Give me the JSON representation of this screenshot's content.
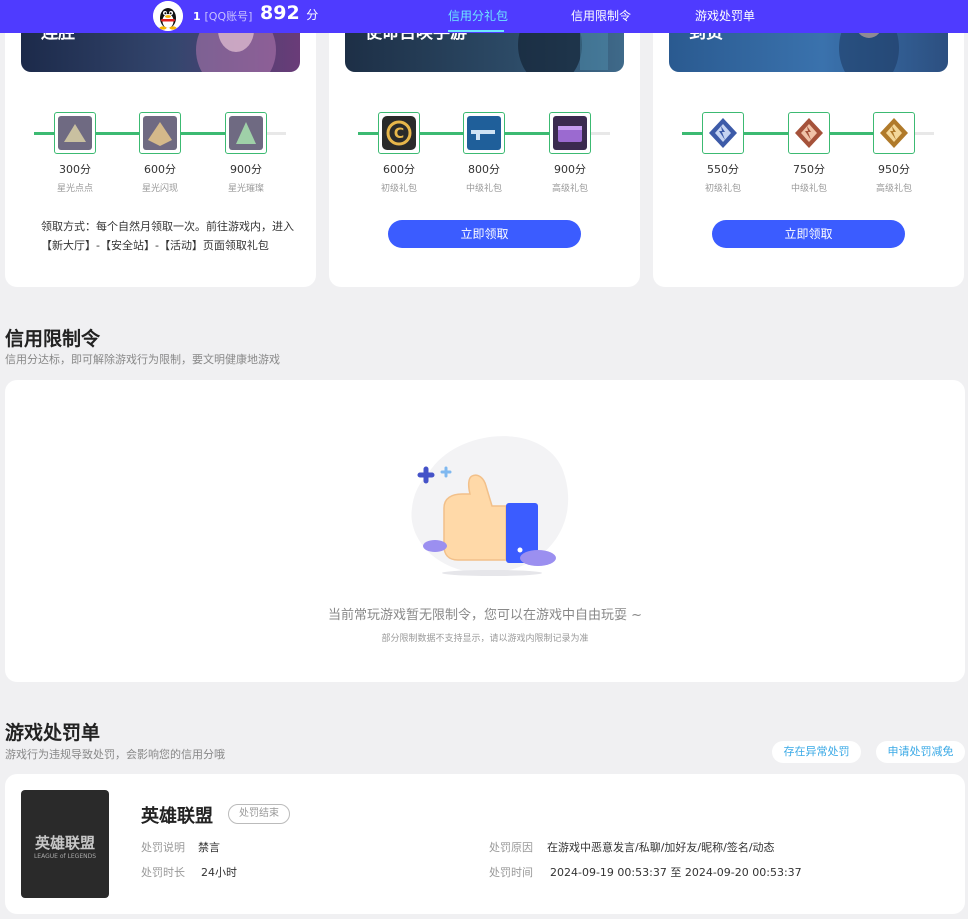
{
  "header": {
    "account_id": "1",
    "account_type": "[QQ账号]",
    "score": "892",
    "score_unit": "分",
    "nav": [
      {
        "label": "信用分礼包"
      },
      {
        "label": "信用限制令"
      },
      {
        "label": "游戏处罚单"
      }
    ]
  },
  "gift_cards": [
    {
      "banner_text": "连胜",
      "tiers": [
        {
          "points": "300分",
          "name": "星光点点"
        },
        {
          "points": "600分",
          "name": "星光闪现"
        },
        {
          "points": "900分",
          "name": "星光璀璨"
        }
      ],
      "progress_fraction": 0.8,
      "howto": "领取方式：每个自然月领取一次。前往游戏内，进入【新大厅】-【安全站】-【活动】页面领取礼包"
    },
    {
      "banner_text": "使命召唤手游",
      "tiers": [
        {
          "points": "600分",
          "name": "初级礼包"
        },
        {
          "points": "800分",
          "name": "中级礼包"
        },
        {
          "points": "900分",
          "name": "高级礼包"
        }
      ],
      "progress_fraction": 0.8,
      "claim_label": "立即领取"
    },
    {
      "banner_text": "到货",
      "tiers": [
        {
          "points": "550分",
          "name": "初级礼包"
        },
        {
          "points": "750分",
          "name": "中级礼包"
        },
        {
          "points": "950分",
          "name": "高级礼包"
        }
      ],
      "progress_fraction": 0.8,
      "claim_label": "立即领取"
    }
  ],
  "restriction": {
    "title": "信用限制令",
    "subtitle": "信用分达标，即可解除游戏行为限制，要文明健康地游戏",
    "empty_main": "当前常玩游戏暂无限制令，您可以在游戏中自由玩耍 ~",
    "empty_sub": "部分限制数据不支持显示，请以游戏内限制记录为准"
  },
  "penalty": {
    "title": "游戏处罚单",
    "subtitle": "游戏行为违规导致处罚，会影响您的信用分哦",
    "btn_abnormal": "存在异常处罚",
    "btn_reduce": "申请处罚减免",
    "item": {
      "logo_text": "英雄联盟",
      "logo_sub": "LEAGUE of LEGENDS",
      "game": "英雄联盟",
      "status": "处罚结束",
      "desc_label": "处罚说明",
      "desc_value": "禁言",
      "dur_label": "处罚时长",
      "dur_value": "24小时",
      "reason_label": "处罚原因",
      "reason_value": "在游戏中恶意发言/私聊/加好友/昵称/签名/动态",
      "time_label": "处罚时间",
      "time_value": "2024-09-19 00:53:37 至 2024-09-20 00:53:37"
    }
  },
  "colors": {
    "topbar": "#4f3bff",
    "accent_blue": "#3b5cff",
    "progress_green": "#3cba72",
    "nav_active": "#6ee7ff",
    "pill_text": "#3aa9e6"
  }
}
